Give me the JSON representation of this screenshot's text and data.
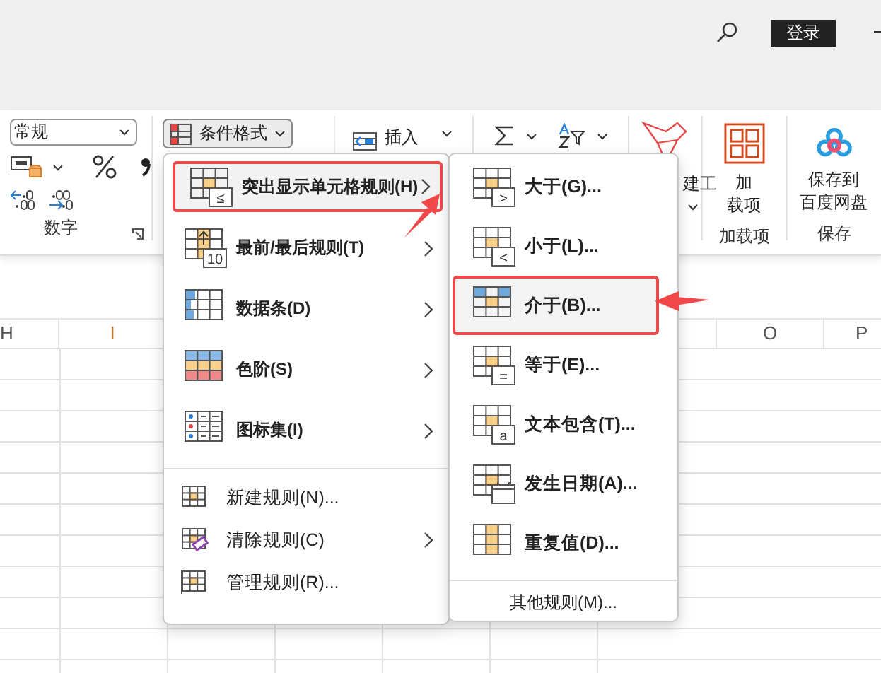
{
  "title_bar": {
    "login_button": "登录"
  },
  "ribbon": {
    "number_format": "常规",
    "number_label": "数字",
    "conditional_format": {
      "label": "条件格式",
      "selected": true
    },
    "insert": "插入",
    "tools_label": "建工",
    "addins": {
      "button": "加载项",
      "label": "加载项"
    },
    "save": {
      "button": "保存到百度网盘",
      "label": "保存"
    }
  },
  "columns": [
    {
      "label": "H",
      "selected": false
    },
    {
      "label": "I",
      "selected": true
    },
    {
      "label": "O",
      "selected": false
    },
    {
      "label": "P",
      "selected": false
    }
  ],
  "menu": {
    "items": [
      {
        "kind": "large",
        "text": "突出显示单元格规则(H)",
        "badge": "≤",
        "submenu": true,
        "selected": true
      },
      {
        "kind": "large",
        "text": "最前/最后规则(T)",
        "badge": "10",
        "submenu": true,
        "selected": false
      },
      {
        "kind": "large",
        "text": "数据条(D)",
        "submenu": true,
        "selected": false
      },
      {
        "kind": "large",
        "text": "色阶(S)",
        "submenu": true,
        "selected": false
      },
      {
        "kind": "large",
        "text": "图标集(I)",
        "submenu": true,
        "selected": false
      },
      {
        "kind": "small",
        "text": "新建规则(N)...",
        "submenu": false,
        "selected": false
      },
      {
        "kind": "small",
        "text": "清除规则(C)",
        "submenu": true,
        "selected": false
      },
      {
        "kind": "small",
        "text": "管理规则(R)...",
        "submenu": false,
        "selected": false
      }
    ]
  },
  "submenu": {
    "items": [
      {
        "text": "大于(G)...",
        "badge": ">",
        "selected": false
      },
      {
        "text": "小于(L)...",
        "badge": "<",
        "selected": false
      },
      {
        "text": "介于(B)...",
        "selected": true
      },
      {
        "text": "等于(E)...",
        "badge": "=",
        "selected": false
      },
      {
        "text": "文本包含(T)...",
        "badge": "a",
        "selected": false
      },
      {
        "text": "发生日期(A)...",
        "selected": false
      },
      {
        "text": "重复值(D)...",
        "selected": false
      }
    ],
    "footer": "其他规则(M)..."
  }
}
